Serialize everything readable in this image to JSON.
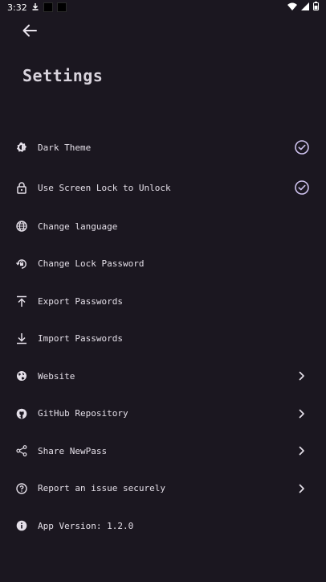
{
  "status_bar": {
    "time": "3:32"
  },
  "header": {
    "title": "Settings"
  },
  "settings": [
    {
      "label": "Dark Theme",
      "icon": "contrast-icon",
      "trailing": "check-circle-icon"
    },
    {
      "label": "Use Screen Lock to Unlock",
      "icon": "lock-icon",
      "trailing": "check-circle-icon"
    },
    {
      "label": "Change language",
      "icon": "globe-icon",
      "trailing": ""
    },
    {
      "label": "Change Lock Password",
      "icon": "lock-reset-icon",
      "trailing": ""
    },
    {
      "label": "Export Passwords",
      "icon": "upload-icon",
      "trailing": ""
    },
    {
      "label": "Import Passwords",
      "icon": "download-icon",
      "trailing": ""
    },
    {
      "label": "Website",
      "icon": "globe-icon",
      "trailing": "chevron-right-icon"
    },
    {
      "label": "GitHub Repository",
      "icon": "github-icon",
      "trailing": "chevron-right-icon"
    },
    {
      "label": "Share NewPass",
      "icon": "share-icon",
      "trailing": "chevron-right-icon"
    },
    {
      "label": "Report an issue securely",
      "icon": "help-circle-icon",
      "trailing": "chevron-right-icon"
    },
    {
      "label": "App Version: 1.2.0",
      "icon": "info-icon",
      "trailing": ""
    }
  ],
  "colors": {
    "background": "#1b1720",
    "text": "#e4dfe8",
    "accent": "#cfc3ef"
  }
}
